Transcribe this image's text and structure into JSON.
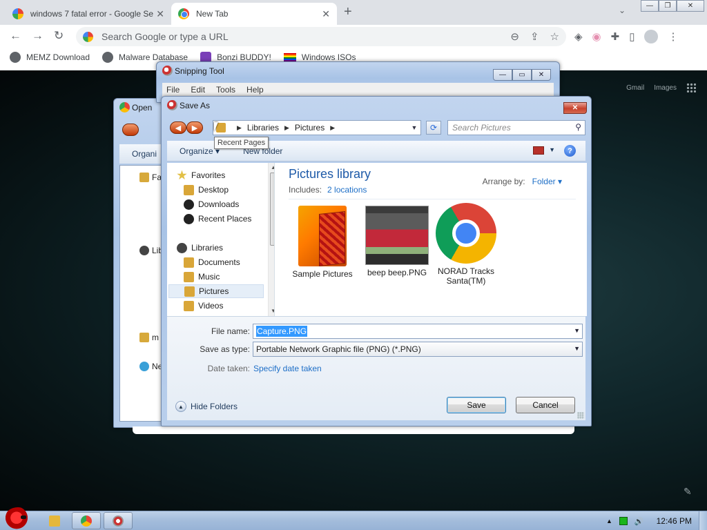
{
  "browser": {
    "tabs": [
      {
        "title": "windows 7 fatal error - Google Se",
        "close": "✕"
      },
      {
        "title": "New Tab",
        "close": "✕"
      }
    ],
    "new_tab": "+",
    "tab_search": "⌄",
    "window_controls": {
      "minimize": "—",
      "restore": "❐",
      "close": "✕"
    },
    "nav": {
      "back": "←",
      "forward": "→",
      "reload": "↻"
    },
    "omnibox_placeholder": "Search Google or type a URL",
    "omnibox_icons": {
      "zoom": "⊖",
      "share": "⇪",
      "bookmark": "☆"
    },
    "extensions": {
      "ublock": "◈",
      "ext2": "◉",
      "puzzle": "✚",
      "sidepanel": "▯",
      "menu": "⋮"
    },
    "bookmarks": [
      "MEMZ Download",
      "Malware Database",
      "Bonzi BUDDY!",
      "Windows ISOs"
    ],
    "newtab_links": [
      "Gmail",
      "Images"
    ],
    "edit_icon": "✎"
  },
  "open_dialog": {
    "title": "Open",
    "organize": "Organi",
    "rows": [
      "Fa",
      "Lib",
      "m",
      "Ne"
    ]
  },
  "snipping_tool": {
    "title": "Snipping Tool",
    "menu": [
      "File",
      "Edit",
      "Tools",
      "Help"
    ],
    "controls": {
      "minimize": "—",
      "maximize": "▭",
      "close": "✕"
    }
  },
  "save_as": {
    "title": "Save As",
    "close": "✕",
    "nav_back": "◀",
    "nav_forward": "▶",
    "breadcrumb": [
      "Libraries",
      "Pictures"
    ],
    "breadcrumb_sep": "▶",
    "address_dropdown": "▼",
    "refresh_icon": "⟳",
    "search_placeholder": "Search Pictures",
    "search_icon": "⚲",
    "tooltip": "Recent Pages",
    "organize": "Organize ▾",
    "new_folder": "New folder",
    "view_dropdown": "▼",
    "help": "?",
    "nav_items": [
      {
        "label": "Favorites",
        "level": "group"
      },
      {
        "label": "Desktop"
      },
      {
        "label": "Downloads"
      },
      {
        "label": "Recent Places"
      },
      {
        "label": "Libraries",
        "level": "group"
      },
      {
        "label": "Documents"
      },
      {
        "label": "Music"
      },
      {
        "label": "Pictures",
        "selected": true
      },
      {
        "label": "Videos"
      }
    ],
    "scroll_up": "▲",
    "scroll_down": "▼",
    "library_title": "Pictures library",
    "includes_label": "Includes:",
    "includes_link": "2 locations",
    "arrange_label": "Arrange by:",
    "arrange_value": "Folder ▾",
    "items": [
      {
        "name": "Sample Pictures"
      },
      {
        "name": "beep beep.PNG"
      },
      {
        "name": "NORAD Tracks Santa(TM)"
      }
    ],
    "file_name_label": "File name:",
    "file_name_value": "Capture.PNG",
    "save_type_label": "Save as type:",
    "save_type_value": "Portable Network Graphic file (PNG) (*.PNG)",
    "field_dropdown": "▼",
    "date_taken_label": "Date taken:",
    "date_taken_link": "Specify date taken",
    "hide_folders": "Hide Folders",
    "hide_folders_icon": "▲",
    "save_button": "Save",
    "cancel_button": "Cancel"
  },
  "taskbar": {
    "tray_arrow": "▲",
    "volume_icon": "🔊",
    "clock": "12:46 PM"
  }
}
